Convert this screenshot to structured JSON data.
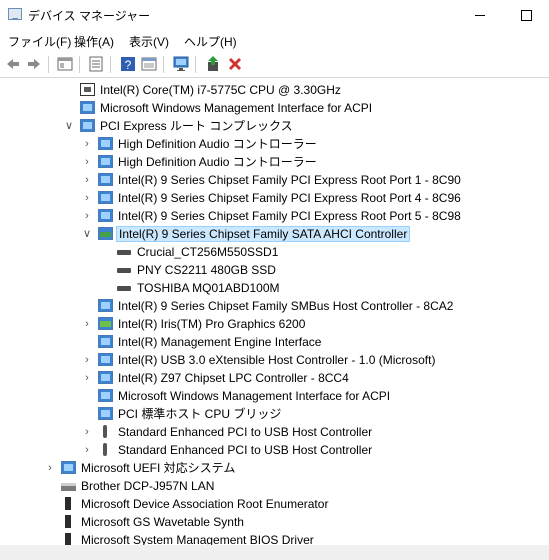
{
  "window": {
    "title": "デバイス マネージャー",
    "minimize_label": "",
    "maximize_label": ""
  },
  "menu": [
    "ファイル(F)",
    "操作(A)",
    "表示(V)",
    "ヘルプ(H)"
  ],
  "toolbar": {
    "buttons": [
      "back-icon",
      "forward-icon",
      "show-hide-icon",
      "properties-icon",
      "help-icon",
      "view-icon",
      "monitor-icon",
      "update-driver-icon",
      "uninstall-icon"
    ],
    "uninstall_color": "#d32f2f",
    "update_color": "#2e9b3a"
  },
  "tree": [
    {
      "label": "Intel(R) Core(TM) i7-5775C CPU @ 3.30GHz",
      "level": 3,
      "expander": "none",
      "icon": "cpu"
    },
    {
      "label": "Microsoft Windows Management Interface for ACPI",
      "level": 3,
      "expander": "none",
      "icon": "sys"
    },
    {
      "label": "PCI Express ルート コンプレックス",
      "level": 3,
      "expander": "open",
      "icon": "sys"
    },
    {
      "label": "High Definition Audio コントローラー",
      "level": 4,
      "expander": "closed",
      "icon": "sys"
    },
    {
      "label": "High Definition Audio コントローラー",
      "level": 4,
      "expander": "closed",
      "icon": "sys"
    },
    {
      "label": "Intel(R) 9 Series Chipset Family PCI Express Root Port 1 - 8C90",
      "level": 4,
      "expander": "closed",
      "icon": "sys"
    },
    {
      "label": "Intel(R) 9 Series Chipset Family PCI Express Root Port 4 - 8C96",
      "level": 4,
      "expander": "closed",
      "icon": "sys"
    },
    {
      "label": "Intel(R) 9 Series Chipset Family PCI Express Root Port 5 - 8C98",
      "level": 4,
      "expander": "closed",
      "icon": "sys"
    },
    {
      "label": "Intel(R) 9 Series Chipset Family SATA AHCI Controller",
      "level": 4,
      "expander": "open",
      "icon": "sata",
      "selected": true
    },
    {
      "label": "Crucial_CT256M550SSD1",
      "level": 5,
      "expander": "none",
      "icon": "disk"
    },
    {
      "label": "PNY CS2211 480GB SSD",
      "level": 5,
      "expander": "none",
      "icon": "disk"
    },
    {
      "label": "TOSHIBA MQ01ABD100M",
      "level": 5,
      "expander": "none",
      "icon": "disk"
    },
    {
      "label": "Intel(R) 9 Series Chipset Family SMBus Host Controller - 8CA2",
      "level": 4,
      "expander": "none",
      "icon": "sys"
    },
    {
      "label": "Intel(R) Iris(TM) Pro Graphics 6200",
      "level": 4,
      "expander": "closed",
      "icon": "gpu"
    },
    {
      "label": "Intel(R) Management Engine Interface",
      "level": 4,
      "expander": "none",
      "icon": "sys"
    },
    {
      "label": "Intel(R) USB 3.0 eXtensible Host Controller - 1.0 (Microsoft)",
      "level": 4,
      "expander": "closed",
      "icon": "sys"
    },
    {
      "label": "Intel(R) Z97 Chipset LPC Controller - 8CC4",
      "level": 4,
      "expander": "closed",
      "icon": "sys"
    },
    {
      "label": "Microsoft Windows Management Interface for ACPI",
      "level": 4,
      "expander": "none",
      "icon": "sys"
    },
    {
      "label": "PCI 標準ホスト CPU ブリッジ",
      "level": 4,
      "expander": "none",
      "icon": "sys"
    },
    {
      "label": "Standard Enhanced PCI to USB Host Controller",
      "level": 4,
      "expander": "closed",
      "icon": "usb"
    },
    {
      "label": "Standard Enhanced PCI to USB Host Controller",
      "level": 4,
      "expander": "closed",
      "icon": "usb"
    },
    {
      "label": "Microsoft UEFI 対応システム",
      "level": 2,
      "expander": "closed",
      "icon": "sys"
    },
    {
      "label": "Brother DCP-J957N LAN",
      "level": 2,
      "expander": "none",
      "icon": "printer"
    },
    {
      "label": "Microsoft Device Association Root Enumerator",
      "level": 2,
      "expander": "none",
      "icon": "enum"
    },
    {
      "label": "Microsoft GS Wavetable Synth",
      "level": 2,
      "expander": "none",
      "icon": "enum"
    },
    {
      "label": "Microsoft System Management BIOS Driver",
      "level": 2,
      "expander": "none",
      "icon": "enum"
    }
  ]
}
